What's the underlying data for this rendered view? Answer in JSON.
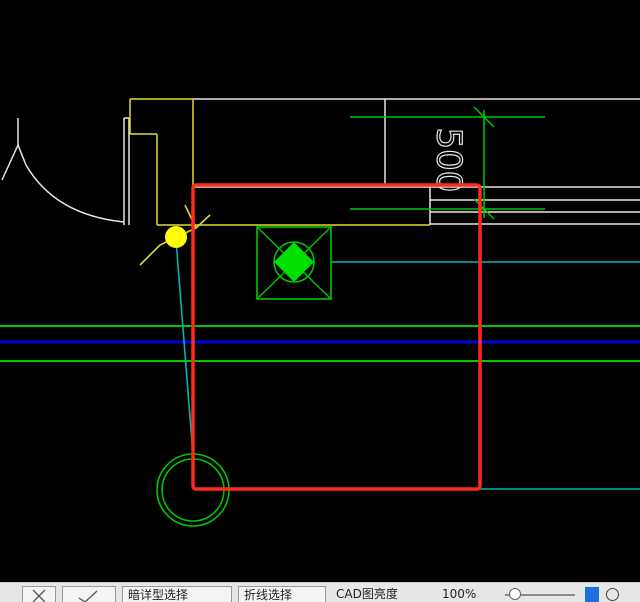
{
  "app": {
    "canvas_background": "#000000",
    "drawing_colors": {
      "outline": "#e6e6e6",
      "door": "#e2dc2a",
      "green": "#00c800",
      "cyan": "#00b4b4",
      "blue": "#0000dc",
      "yellow_marker": "#ffff00",
      "selection": "#ff2a1a"
    }
  },
  "drawing": {
    "dimension_text": "500"
  },
  "statusbar": {
    "icon_x": "cross-icon",
    "icon_check": "check-icon",
    "btn_1_label": "暗详型选择",
    "btn_2_label": "折线选择",
    "opacity_label": "CAD图亮度",
    "opacity_value": "100%",
    "slider_value_percent": 5
  }
}
